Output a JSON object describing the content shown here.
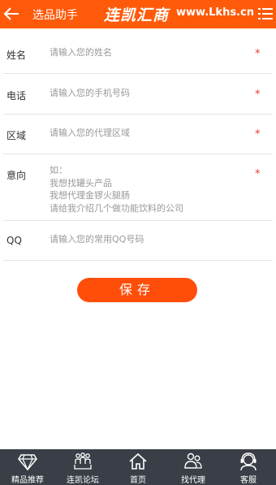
{
  "header": {
    "back_icon": "arrow-left-icon",
    "title": "选品助手",
    "brand_cn": "连凯汇商",
    "brand_url": "www.Lkhs.cn",
    "menu_icon": "list-menu-icon",
    "bg_color": "#ff5a0a"
  },
  "form": {
    "name": {
      "label": "姓名",
      "placeholder": "请输入您的姓名",
      "required": "*"
    },
    "phone": {
      "label": "电话",
      "placeholder": "请输入您的手机号码",
      "required": "*"
    },
    "region": {
      "label": "区域",
      "placeholder": "请输入您的代理区域",
      "required": "*"
    },
    "intent": {
      "label": "意向",
      "placeholder": "如：\n我想找罐头产品\n我想代理金锣火腿肠\n请给我介绍几个做功能饮料的公司",
      "required": "*"
    },
    "qq": {
      "label": "QQ",
      "placeholder": "请输入您的常用QQ号码"
    }
  },
  "save_button": {
    "label": "保存",
    "color": "#ff4e0a"
  },
  "bottom_nav": {
    "bg_color": "#3a3f47",
    "items": [
      {
        "label": "精品推荐",
        "icon": "diamond-icon"
      },
      {
        "label": "连凯论坛",
        "icon": "forum-people-icon"
      },
      {
        "label": "首页",
        "icon": "home-icon"
      },
      {
        "label": "找代理",
        "icon": "agents-icon"
      },
      {
        "label": "客服",
        "icon": "customer-service-icon"
      }
    ]
  }
}
